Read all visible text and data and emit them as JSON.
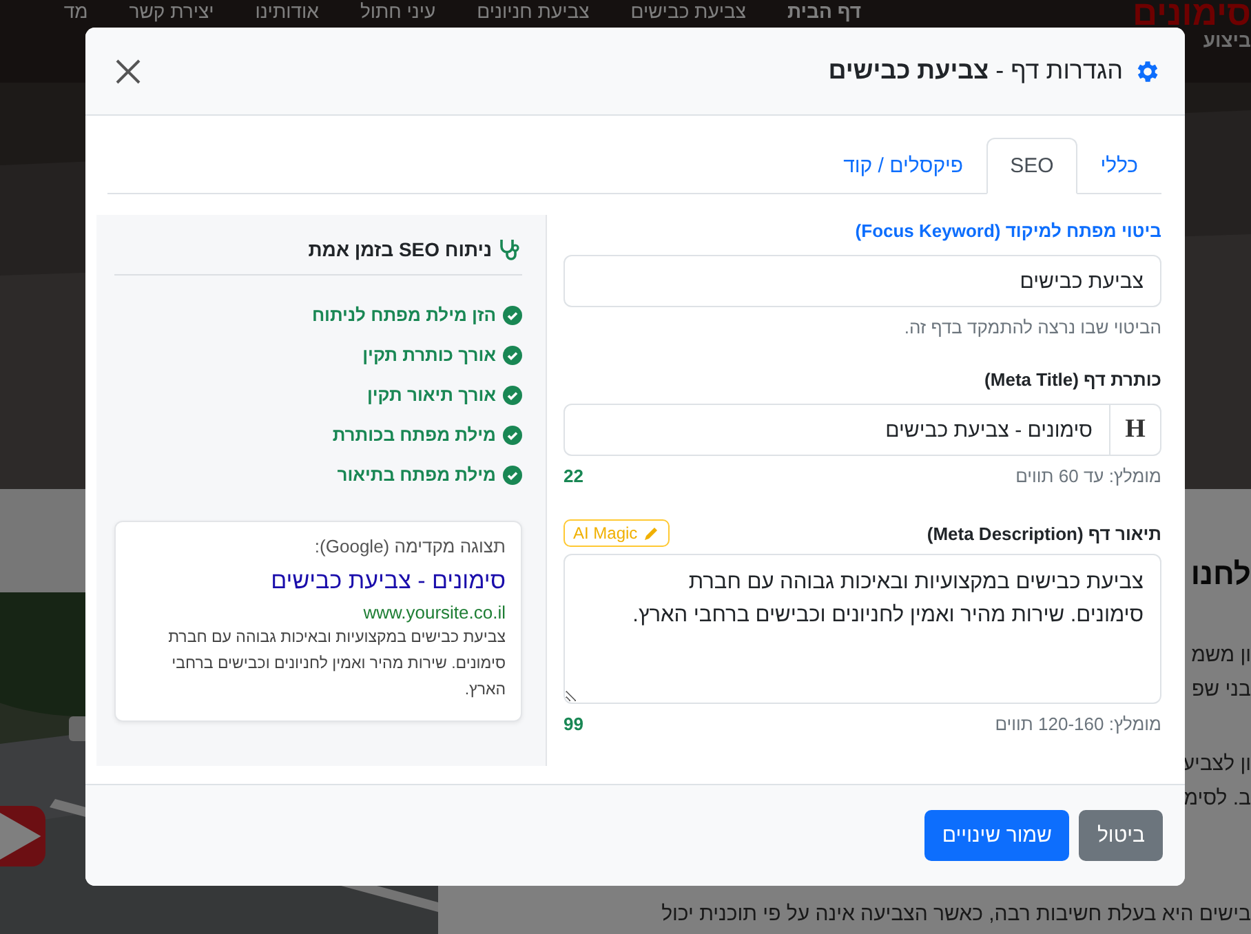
{
  "site": {
    "logo": "סימונים",
    "tagline": "ביצוע",
    "nav": [
      {
        "label": "דף הבית",
        "selected": true
      },
      {
        "label": "צביעת כבישים",
        "selected": false
      },
      {
        "label": "צביעת חניונים",
        "selected": false
      },
      {
        "label": "עיני חתול",
        "selected": false
      },
      {
        "label": "אודותינו",
        "selected": false
      },
      {
        "label": "יצירת קשר",
        "selected": false
      },
      {
        "label": "מד",
        "selected": false
      }
    ],
    "article": [
      {
        "kind": "heading",
        "lines": [
          "לחנו"
        ]
      },
      {
        "kind": "paragraph",
        "lines": [
          "ון משמ",
          "בני שפ"
        ]
      },
      {
        "kind": "paragraph",
        "lines": [
          "ון לצביע",
          "ב. לסימ"
        ]
      },
      {
        "kind": "paragraph",
        "lines": [
          "בישים היא בעלת חשיבות רבה, כאשר הצביעה אינה על פי תוכנית יכול"
        ]
      }
    ]
  },
  "dialog": {
    "title": "הגדרות דף - **צביעת כבישים**",
    "tabs": [
      {
        "label": "כללי",
        "selected": false
      },
      {
        "label": "SEO",
        "selected": true
      },
      {
        "label": "פיקסלים / קוד",
        "selected": false
      }
    ],
    "fields": [
      {
        "kind": "focus",
        "label": "ביטוי מפתח למיקוד (Focus Keyword)",
        "value": "צביעת כבישים",
        "hint": "הביטוי שבו נרצה להתמקד בדף זה."
      },
      {
        "kind": "title",
        "label": "כותרת דף (Meta Title)",
        "prefix": "H",
        "value": "סימונים - צביעת כבישים",
        "hint": "מומלץ: עד 60 תווים",
        "count": "22"
      },
      {
        "kind": "description",
        "label": "תיאור דף (Meta Description)",
        "action": "AI Magic",
        "value": "צביעת כבישים במקצועיות ובאיכות גבוהה עם חברת סימונים. שירות מהיר ואמין לחניונים וכבישים ברחבי הארץ.",
        "hint": "מומלץ: 120-160 תווים",
        "count": "99"
      }
    ],
    "analysis": {
      "title": "ניתוח SEO בזמן אמת",
      "checks": [
        {
          "label": "הזן מילת מפתח לניתוח",
          "passed": true
        },
        {
          "label": "אורך כותרת תקין",
          "passed": true
        },
        {
          "label": "אורך תיאור תקין",
          "passed": true
        },
        {
          "label": "מילת מפתח בכותרת",
          "passed": true
        },
        {
          "label": "מילת מפתח בתיאור",
          "passed": true
        }
      ],
      "preview": {
        "heading": "תצוגה מקדימה (Google):",
        "title": "סימונים - צביעת כבישים",
        "url": "www.yoursite.co.il",
        "description": "צביעת כבישים במקצועיות ובאיכות גבוהה עם חברת סימונים. שירות מהיר ואמין לחניונים וכבישים ברחבי הארץ."
      }
    },
    "buttons": [
      {
        "kind": "secondary",
        "label": "ביטול"
      },
      {
        "kind": "primary",
        "label": "שמור שינויים"
      }
    ]
  }
}
